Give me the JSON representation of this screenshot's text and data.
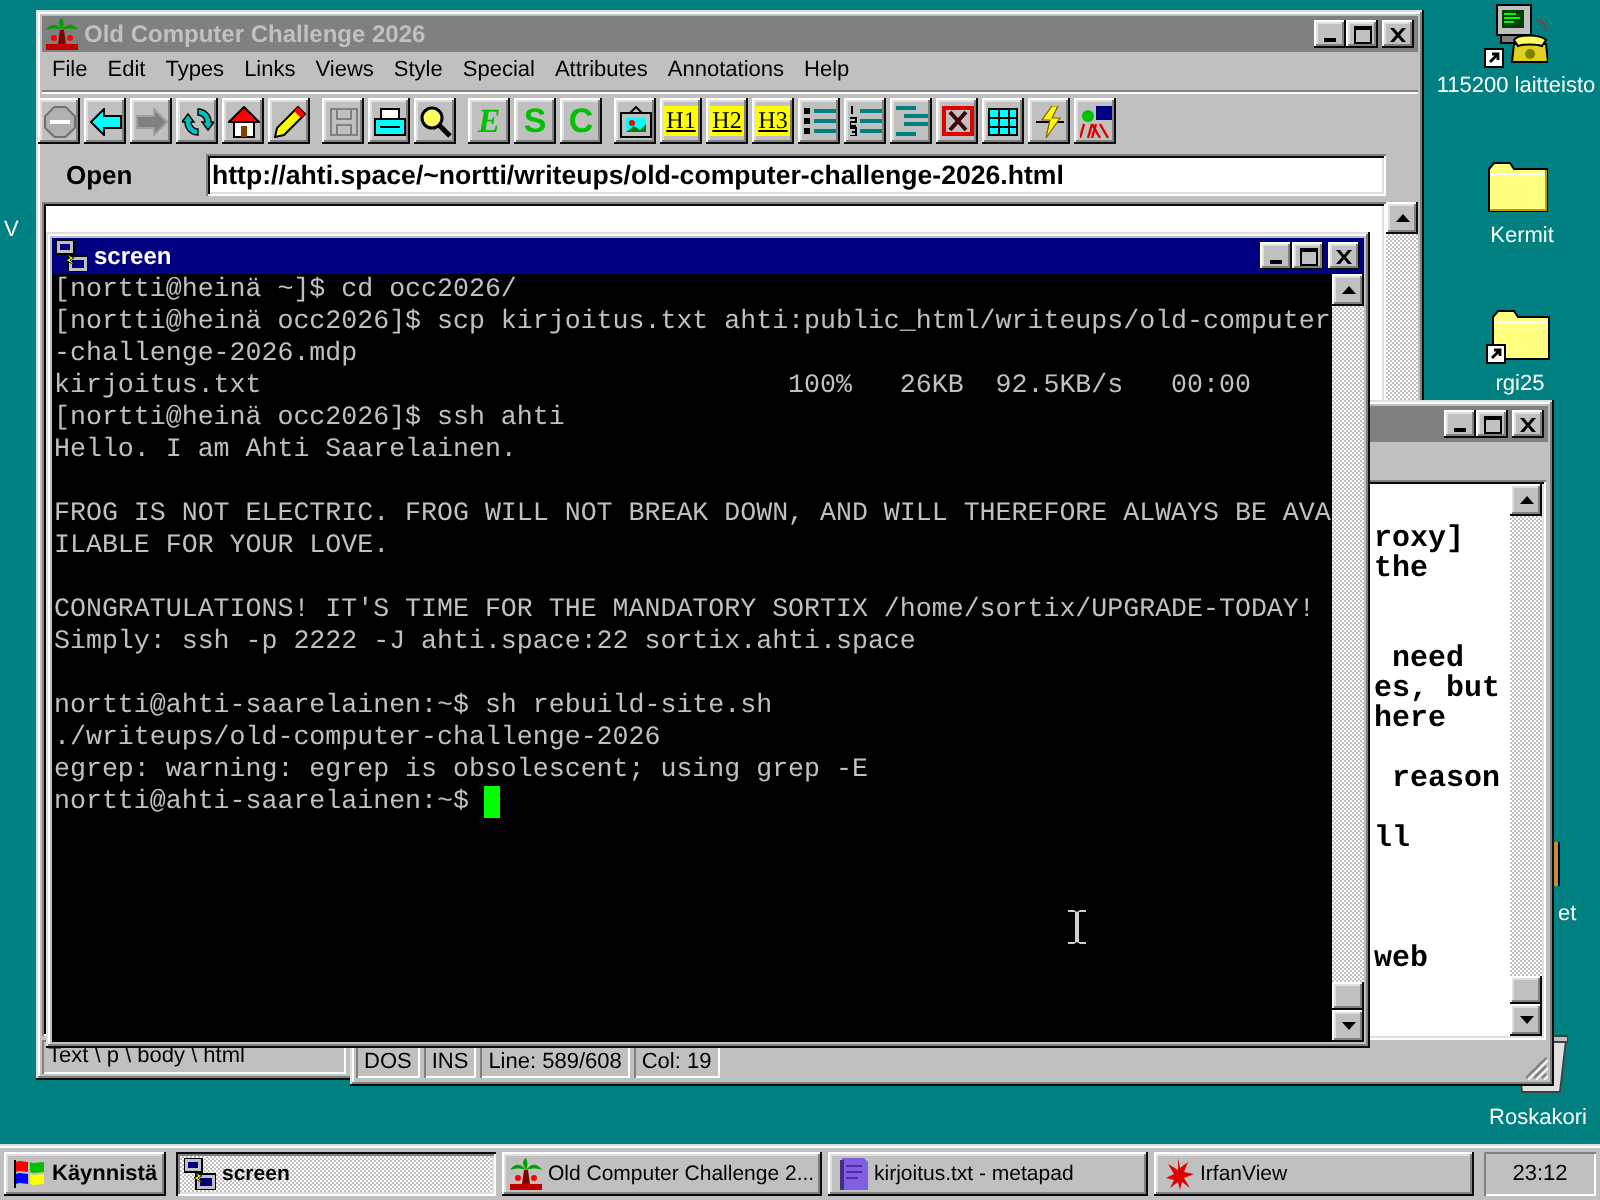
{
  "desktop_icons": [
    {
      "kind": "dialer_shortcut",
      "label": "115200 laitteisto"
    },
    {
      "kind": "folder",
      "label": "Kermit"
    },
    {
      "kind": "folder_shortcut",
      "label": "rgi25"
    },
    {
      "kind": "covered",
      "label": "et"
    },
    {
      "kind": "recycle_bin",
      "label": "Roskakori"
    },
    {
      "kind": "label_only",
      "label": "V"
    }
  ],
  "browser": {
    "title": "Old Computer Challenge 2026",
    "active": false,
    "menu": [
      "File",
      "Edit",
      "Types",
      "Links",
      "Views",
      "Style",
      "Special",
      "Attributes",
      "Annotations",
      "Help"
    ],
    "toolbar": {
      "forward_disabled": true,
      "save_disabled": true,
      "text_styles": [
        "E",
        "S",
        "C"
      ],
      "headings": [
        "H1",
        "H2",
        "H3"
      ]
    },
    "address_label": "Open",
    "url": "http://ahti.space/~nortti/writeups/old-computer-challenge-2026.html",
    "status_path": "Text \\ p \\ body \\ html"
  },
  "editor": {
    "active": false,
    "text_blocks": [
      [
        "roxy]",
        "the"
      ],
      [
        " need",
        "es, but",
        "here"
      ],
      [
        " reason"
      ],
      [
        "ll"
      ],
      [
        "web"
      ]
    ],
    "status": [
      "DOS",
      "INS",
      "Line: 589/608",
      "Col: 19"
    ]
  },
  "terminal": {
    "title": "screen",
    "active": true,
    "blocks": [
      [
        "[nortti@heinä ~]$ cd occ2026/",
        "[nortti@heinä occ2026]$ scp kirjoitus.txt ahti:public_html/writeups/old-computer",
        "-challenge-2026.mdp",
        "kirjoitus.txt                                 100%   26KB  92.5KB/s   00:00",
        "[nortti@heinä occ2026]$ ssh ahti",
        "Hello. I am Ahti Saarelainen."
      ],
      [
        "FROG IS NOT ELECTRIC. FROG WILL NOT BREAK DOWN, AND WILL THEREFORE ALWAYS BE AVA",
        "ILABLE FOR YOUR LOVE."
      ],
      [
        "CONGRATULATIONS! IT'S TIME FOR THE MANDATORY SORTIX /home/sortix/UPGRADE-TODAY!",
        "Simply: ssh -p 2222 -J ahti.space:22 sortix.ahti.space"
      ],
      [
        "nortti@ahti-saarelainen:~$ sh rebuild-site.sh",
        "./writeups/old-computer-challenge-2026",
        "egrep: warning: egrep is obsolescent; using grep -E",
        "nortti@ahti-saarelainen:~$"
      ]
    ],
    "cursor_visible": true
  },
  "taskbar": {
    "start": "Käynnistä",
    "tasks": [
      {
        "kind": "terminal",
        "label": "screen",
        "selected": true
      },
      {
        "kind": "browser",
        "label": "Old Computer Challenge 2...",
        "selected": false
      },
      {
        "kind": "editor",
        "label": "kirjoitus.txt - metapad",
        "selected": false
      },
      {
        "kind": "image_viewer",
        "label": "IrfanView",
        "selected": false
      }
    ],
    "clock": "23:12"
  }
}
